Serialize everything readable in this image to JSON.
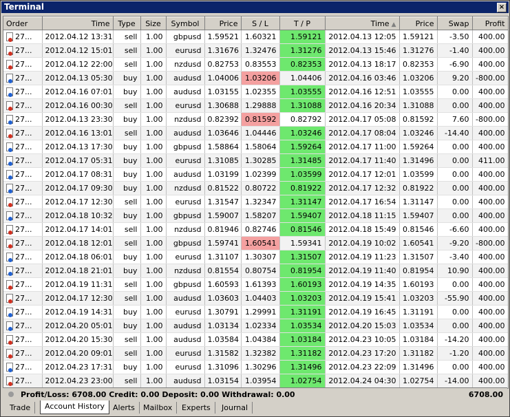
{
  "window": {
    "title": "Terminal",
    "close_glyph": "×"
  },
  "columns": [
    "Order",
    "Time",
    "Type",
    "Size",
    "Symbol",
    "Price",
    "S / L",
    "T / P",
    "Time",
    "Price",
    "Swap",
    "Profit"
  ],
  "rows": [
    {
      "order": "27...",
      "open_time": "2012.04.12 13:31",
      "type": "sell",
      "size": "1.00",
      "symbol": "gbpusd",
      "price": "1.59521",
      "sl": "1.60321",
      "tp": "1.59121",
      "close_time": "2012.04.13 12:05",
      "close_price": "1.59121",
      "swap": "-3.50",
      "profit": "400.00",
      "hl": "tp"
    },
    {
      "order": "27...",
      "open_time": "2012.04.12 15:01",
      "type": "sell",
      "size": "1.00",
      "symbol": "eurusd",
      "price": "1.31676",
      "sl": "1.32476",
      "tp": "1.31276",
      "close_time": "2012.04.13 15:46",
      "close_price": "1.31276",
      "swap": "-1.40",
      "profit": "400.00",
      "hl": "tp"
    },
    {
      "order": "27...",
      "open_time": "2012.04.12 22:00",
      "type": "sell",
      "size": "1.00",
      "symbol": "nzdusd",
      "price": "0.82753",
      "sl": "0.83553",
      "tp": "0.82353",
      "close_time": "2012.04.13 18:17",
      "close_price": "0.82353",
      "swap": "-6.90",
      "profit": "400.00",
      "hl": "tp"
    },
    {
      "order": "27...",
      "open_time": "2012.04.13 05:30",
      "type": "buy",
      "size": "1.00",
      "symbol": "audusd",
      "price": "1.04006",
      "sl": "1.03206",
      "tp": "1.04406",
      "close_time": "2012.04.16 03:46",
      "close_price": "1.03206",
      "swap": "9.20",
      "profit": "-800.00",
      "hl": "sl"
    },
    {
      "order": "27...",
      "open_time": "2012.04.16 07:01",
      "type": "buy",
      "size": "1.00",
      "symbol": "audusd",
      "price": "1.03155",
      "sl": "1.02355",
      "tp": "1.03555",
      "close_time": "2012.04.16 12:51",
      "close_price": "1.03555",
      "swap": "0.00",
      "profit": "400.00",
      "hl": "tp"
    },
    {
      "order": "27...",
      "open_time": "2012.04.16 00:30",
      "type": "sell",
      "size": "1.00",
      "symbol": "eurusd",
      "price": "1.30688",
      "sl": "1.29888",
      "tp": "1.31088",
      "close_time": "2012.04.16 20:34",
      "close_price": "1.31088",
      "swap": "0.00",
      "profit": "400.00",
      "hl": "tp"
    },
    {
      "order": "27...",
      "open_time": "2012.04.13 23:30",
      "type": "buy",
      "size": "1.00",
      "symbol": "nzdusd",
      "price": "0.82392",
      "sl": "0.81592",
      "tp": "0.82792",
      "close_time": "2012.04.17 05:08",
      "close_price": "0.81592",
      "swap": "7.60",
      "profit": "-800.00",
      "hl": "sl"
    },
    {
      "order": "27...",
      "open_time": "2012.04.16 13:01",
      "type": "sell",
      "size": "1.00",
      "symbol": "audusd",
      "price": "1.03646",
      "sl": "1.04446",
      "tp": "1.03246",
      "close_time": "2012.04.17 08:04",
      "close_price": "1.03246",
      "swap": "-14.40",
      "profit": "400.00",
      "hl": "tp"
    },
    {
      "order": "27...",
      "open_time": "2012.04.13 17:30",
      "type": "buy",
      "size": "1.00",
      "symbol": "gbpusd",
      "price": "1.58864",
      "sl": "1.58064",
      "tp": "1.59264",
      "close_time": "2012.04.17 11:00",
      "close_price": "1.59264",
      "swap": "0.00",
      "profit": "400.00",
      "hl": "tp"
    },
    {
      "order": "27...",
      "open_time": "2012.04.17 05:31",
      "type": "buy",
      "size": "1.00",
      "symbol": "eurusd",
      "price": "1.31085",
      "sl": "1.30285",
      "tp": "1.31485",
      "close_time": "2012.04.17 11:40",
      "close_price": "1.31496",
      "swap": "0.00",
      "profit": "411.00",
      "hl": "tp"
    },
    {
      "order": "27...",
      "open_time": "2012.04.17 08:31",
      "type": "buy",
      "size": "1.00",
      "symbol": "audusd",
      "price": "1.03199",
      "sl": "1.02399",
      "tp": "1.03599",
      "close_time": "2012.04.17 12:01",
      "close_price": "1.03599",
      "swap": "0.00",
      "profit": "400.00",
      "hl": "tp"
    },
    {
      "order": "27...",
      "open_time": "2012.04.17 09:30",
      "type": "buy",
      "size": "1.00",
      "symbol": "nzdusd",
      "price": "0.81522",
      "sl": "0.80722",
      "tp": "0.81922",
      "close_time": "2012.04.17 12:32",
      "close_price": "0.81922",
      "swap": "0.00",
      "profit": "400.00",
      "hl": "tp"
    },
    {
      "order": "27...",
      "open_time": "2012.04.17 12:30",
      "type": "sell",
      "size": "1.00",
      "symbol": "eurusd",
      "price": "1.31547",
      "sl": "1.32347",
      "tp": "1.31147",
      "close_time": "2012.04.17 16:54",
      "close_price": "1.31147",
      "swap": "0.00",
      "profit": "400.00",
      "hl": "tp"
    },
    {
      "order": "27...",
      "open_time": "2012.04.18 10:32",
      "type": "buy",
      "size": "1.00",
      "symbol": "gbpusd",
      "price": "1.59007",
      "sl": "1.58207",
      "tp": "1.59407",
      "close_time": "2012.04.18 11:15",
      "close_price": "1.59407",
      "swap": "0.00",
      "profit": "400.00",
      "hl": "tp"
    },
    {
      "order": "27...",
      "open_time": "2012.04.17 14:01",
      "type": "sell",
      "size": "1.00",
      "symbol": "nzdusd",
      "price": "0.81946",
      "sl": "0.82746",
      "tp": "0.81546",
      "close_time": "2012.04.18 15:49",
      "close_price": "0.81546",
      "swap": "-6.60",
      "profit": "400.00",
      "hl": "tp"
    },
    {
      "order": "27...",
      "open_time": "2012.04.18 12:01",
      "type": "sell",
      "size": "1.00",
      "symbol": "gbpusd",
      "price": "1.59741",
      "sl": "1.60541",
      "tp": "1.59341",
      "close_time": "2012.04.19 10:02",
      "close_price": "1.60541",
      "swap": "-9.20",
      "profit": "-800.00",
      "hl": "sl"
    },
    {
      "order": "27...",
      "open_time": "2012.04.18 06:01",
      "type": "buy",
      "size": "1.00",
      "symbol": "eurusd",
      "price": "1.31107",
      "sl": "1.30307",
      "tp": "1.31507",
      "close_time": "2012.04.19 11:23",
      "close_price": "1.31507",
      "swap": "-3.40",
      "profit": "400.00",
      "hl": "tp"
    },
    {
      "order": "27...",
      "open_time": "2012.04.18 21:01",
      "type": "buy",
      "size": "1.00",
      "symbol": "nzdusd",
      "price": "0.81554",
      "sl": "0.80754",
      "tp": "0.81954",
      "close_time": "2012.04.19 11:40",
      "close_price": "0.81954",
      "swap": "10.90",
      "profit": "400.00",
      "hl": "tp"
    },
    {
      "order": "27...",
      "open_time": "2012.04.19 11:31",
      "type": "sell",
      "size": "1.00",
      "symbol": "gbpusd",
      "price": "1.60593",
      "sl": "1.61393",
      "tp": "1.60193",
      "close_time": "2012.04.19 14:35",
      "close_price": "1.60193",
      "swap": "0.00",
      "profit": "400.00",
      "hl": "tp"
    },
    {
      "order": "27...",
      "open_time": "2012.04.17 12:30",
      "type": "sell",
      "size": "1.00",
      "symbol": "audusd",
      "price": "1.03603",
      "sl": "1.04403",
      "tp": "1.03203",
      "close_time": "2012.04.19 15:41",
      "close_price": "1.03203",
      "swap": "-55.90",
      "profit": "400.00",
      "hl": "tp"
    },
    {
      "order": "27...",
      "open_time": "2012.04.19 14:31",
      "type": "buy",
      "size": "1.00",
      "symbol": "eurusd",
      "price": "1.30791",
      "sl": "1.29991",
      "tp": "1.31191",
      "close_time": "2012.04.19 16:45",
      "close_price": "1.31191",
      "swap": "0.00",
      "profit": "400.00",
      "hl": "tp"
    },
    {
      "order": "27...",
      "open_time": "2012.04.20 05:01",
      "type": "buy",
      "size": "1.00",
      "symbol": "audusd",
      "price": "1.03134",
      "sl": "1.02334",
      "tp": "1.03534",
      "close_time": "2012.04.20 15:03",
      "close_price": "1.03534",
      "swap": "0.00",
      "profit": "400.00",
      "hl": "tp"
    },
    {
      "order": "27...",
      "open_time": "2012.04.20 15:30",
      "type": "sell",
      "size": "1.00",
      "symbol": "audusd",
      "price": "1.03584",
      "sl": "1.04384",
      "tp": "1.03184",
      "close_time": "2012.04.23 10:05",
      "close_price": "1.03184",
      "swap": "-14.20",
      "profit": "400.00",
      "hl": "tp"
    },
    {
      "order": "27...",
      "open_time": "2012.04.20 09:01",
      "type": "sell",
      "size": "1.00",
      "symbol": "eurusd",
      "price": "1.31582",
      "sl": "1.32382",
      "tp": "1.31182",
      "close_time": "2012.04.23 17:20",
      "close_price": "1.31182",
      "swap": "-1.20",
      "profit": "400.00",
      "hl": "tp"
    },
    {
      "order": "27...",
      "open_time": "2012.04.23 17:31",
      "type": "buy",
      "size": "1.00",
      "symbol": "eurusd",
      "price": "1.31096",
      "sl": "1.30296",
      "tp": "1.31496",
      "close_time": "2012.04.23 22:09",
      "close_price": "1.31496",
      "swap": "0.00",
      "profit": "400.00",
      "hl": "tp"
    },
    {
      "order": "27...",
      "open_time": "2012.04.23 23:00",
      "type": "sell",
      "size": "1.00",
      "symbol": "audusd",
      "price": "1.03154",
      "sl": "1.03954",
      "tp": "1.02754",
      "close_time": "2012.04.24 04:30",
      "close_price": "1.02754",
      "swap": "-14.00",
      "profit": "400.00",
      "hl": "tp"
    }
  ],
  "status": {
    "summary": "Profit/Loss: 6708.00  Credit: 0.00  Deposit: 0.00  Withdrawal: 0.00",
    "total": "6708.00"
  },
  "tabs": [
    "Trade",
    "Account History",
    "Alerts",
    "Mailbox",
    "Experts",
    "Journal"
  ],
  "active_tab": "Account History",
  "colors": {
    "tp_highlight": "#6ee86e",
    "sl_highlight": "#f4a0a0",
    "titlebar": "#0a246a"
  }
}
